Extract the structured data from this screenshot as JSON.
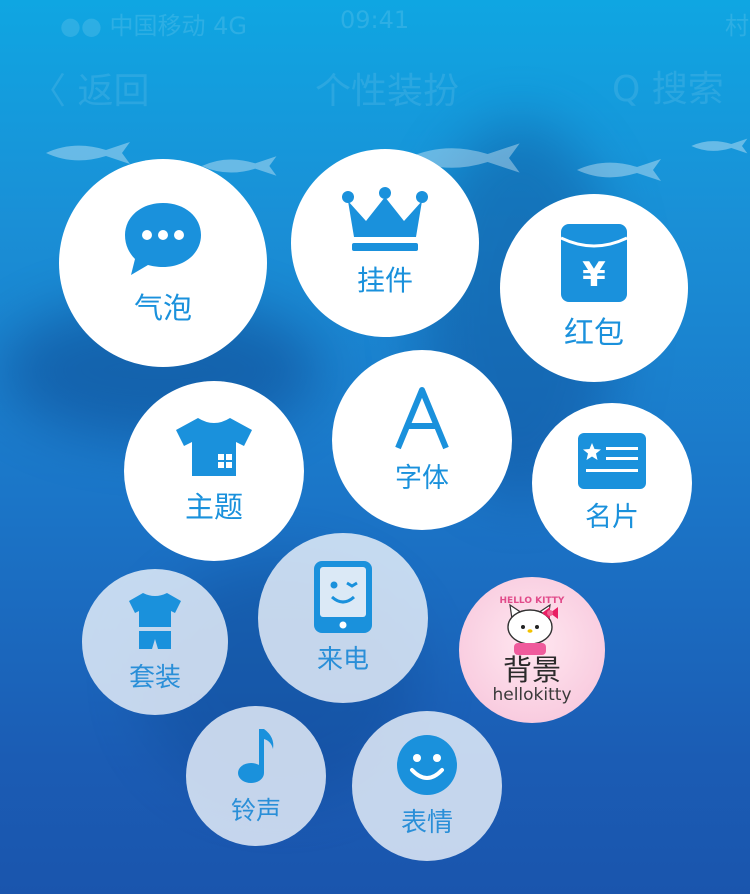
{
  "status_bar": {
    "carrier": "●● 中国移动 4G",
    "time": "09:41",
    "right": "村"
  },
  "nav_bar": {
    "back": "〈 返回",
    "title": "个性装扮",
    "search": "Q 搜索"
  },
  "colors": {
    "accent": "#1a91dc",
    "background_top": "#0fa6e2",
    "background_bottom": "#1a55ad"
  },
  "bubbles": [
    {
      "label": "气泡",
      "icon": "chat-bubble-icon",
      "style": "solid"
    },
    {
      "label": "挂件",
      "icon": "crown-icon",
      "style": "solid"
    },
    {
      "label": "红包",
      "icon": "red-envelope-icon",
      "style": "solid"
    },
    {
      "label": "主题",
      "icon": "tshirt-icon",
      "style": "solid"
    },
    {
      "label": "字体",
      "icon": "letter-a-icon",
      "style": "solid"
    },
    {
      "label": "名片",
      "icon": "card-icon",
      "style": "solid"
    },
    {
      "label": "套装",
      "icon": "outfit-icon",
      "style": "faded"
    },
    {
      "label": "来电",
      "icon": "phone-smile-icon",
      "style": "faded"
    },
    {
      "label": "背景",
      "sub": "hellokitty",
      "icon": "hello-kitty-icon",
      "style": "featured"
    },
    {
      "label": "铃声",
      "icon": "music-note-icon",
      "style": "faded"
    },
    {
      "label": "表情",
      "icon": "smiley-icon",
      "style": "faded"
    }
  ]
}
